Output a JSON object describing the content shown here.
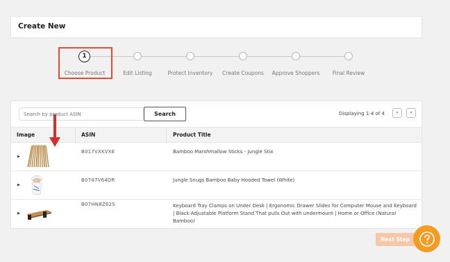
{
  "header": {
    "title": "Create New"
  },
  "stepper": {
    "active_number": "1",
    "steps": [
      {
        "label": "Choose Product"
      },
      {
        "label": "Edit Listing"
      },
      {
        "label": "Protect Inventory"
      },
      {
        "label": "Create Coupons"
      },
      {
        "label": "Approve Shoppers"
      },
      {
        "label": "Final Review"
      }
    ]
  },
  "search": {
    "placeholder": "Search by product ASIN",
    "button_label": "Search"
  },
  "pagination": {
    "displaying": "Displaying 1-4 of 4",
    "prev_icon": "«",
    "next_icon": "»"
  },
  "table": {
    "columns": [
      "Image",
      "ASIN",
      "Product Title"
    ],
    "rows": [
      {
        "asin": "B017VXKVXE",
        "title": "Bamboo Marshmallow Sticks - Jungle Stix"
      },
      {
        "asin": "B0747V64DR",
        "title": "Jungle Snugs Bamboo Baby Hooded Towel (White)"
      },
      {
        "asin": "B07HN8Z62S",
        "title": "Keyboard Tray Clamps on Under Desk | Ergonomic Drawer Slides for Computer Mouse and Keyboard | Black Adjustable Platform Stand That pulls Out with undermount | Home or Office (Natural Bamboo)"
      }
    ]
  },
  "footer": {
    "next_step_label": "Next Step"
  },
  "colors": {
    "highlight": "#e24a33",
    "accent_orange": "#f39c21",
    "next_step_disabled": "#f7c7a9"
  },
  "icons": {
    "annotation": "red-down-arrow-icon",
    "help": "question-mark-icon",
    "expander": "caret-right-icon"
  }
}
